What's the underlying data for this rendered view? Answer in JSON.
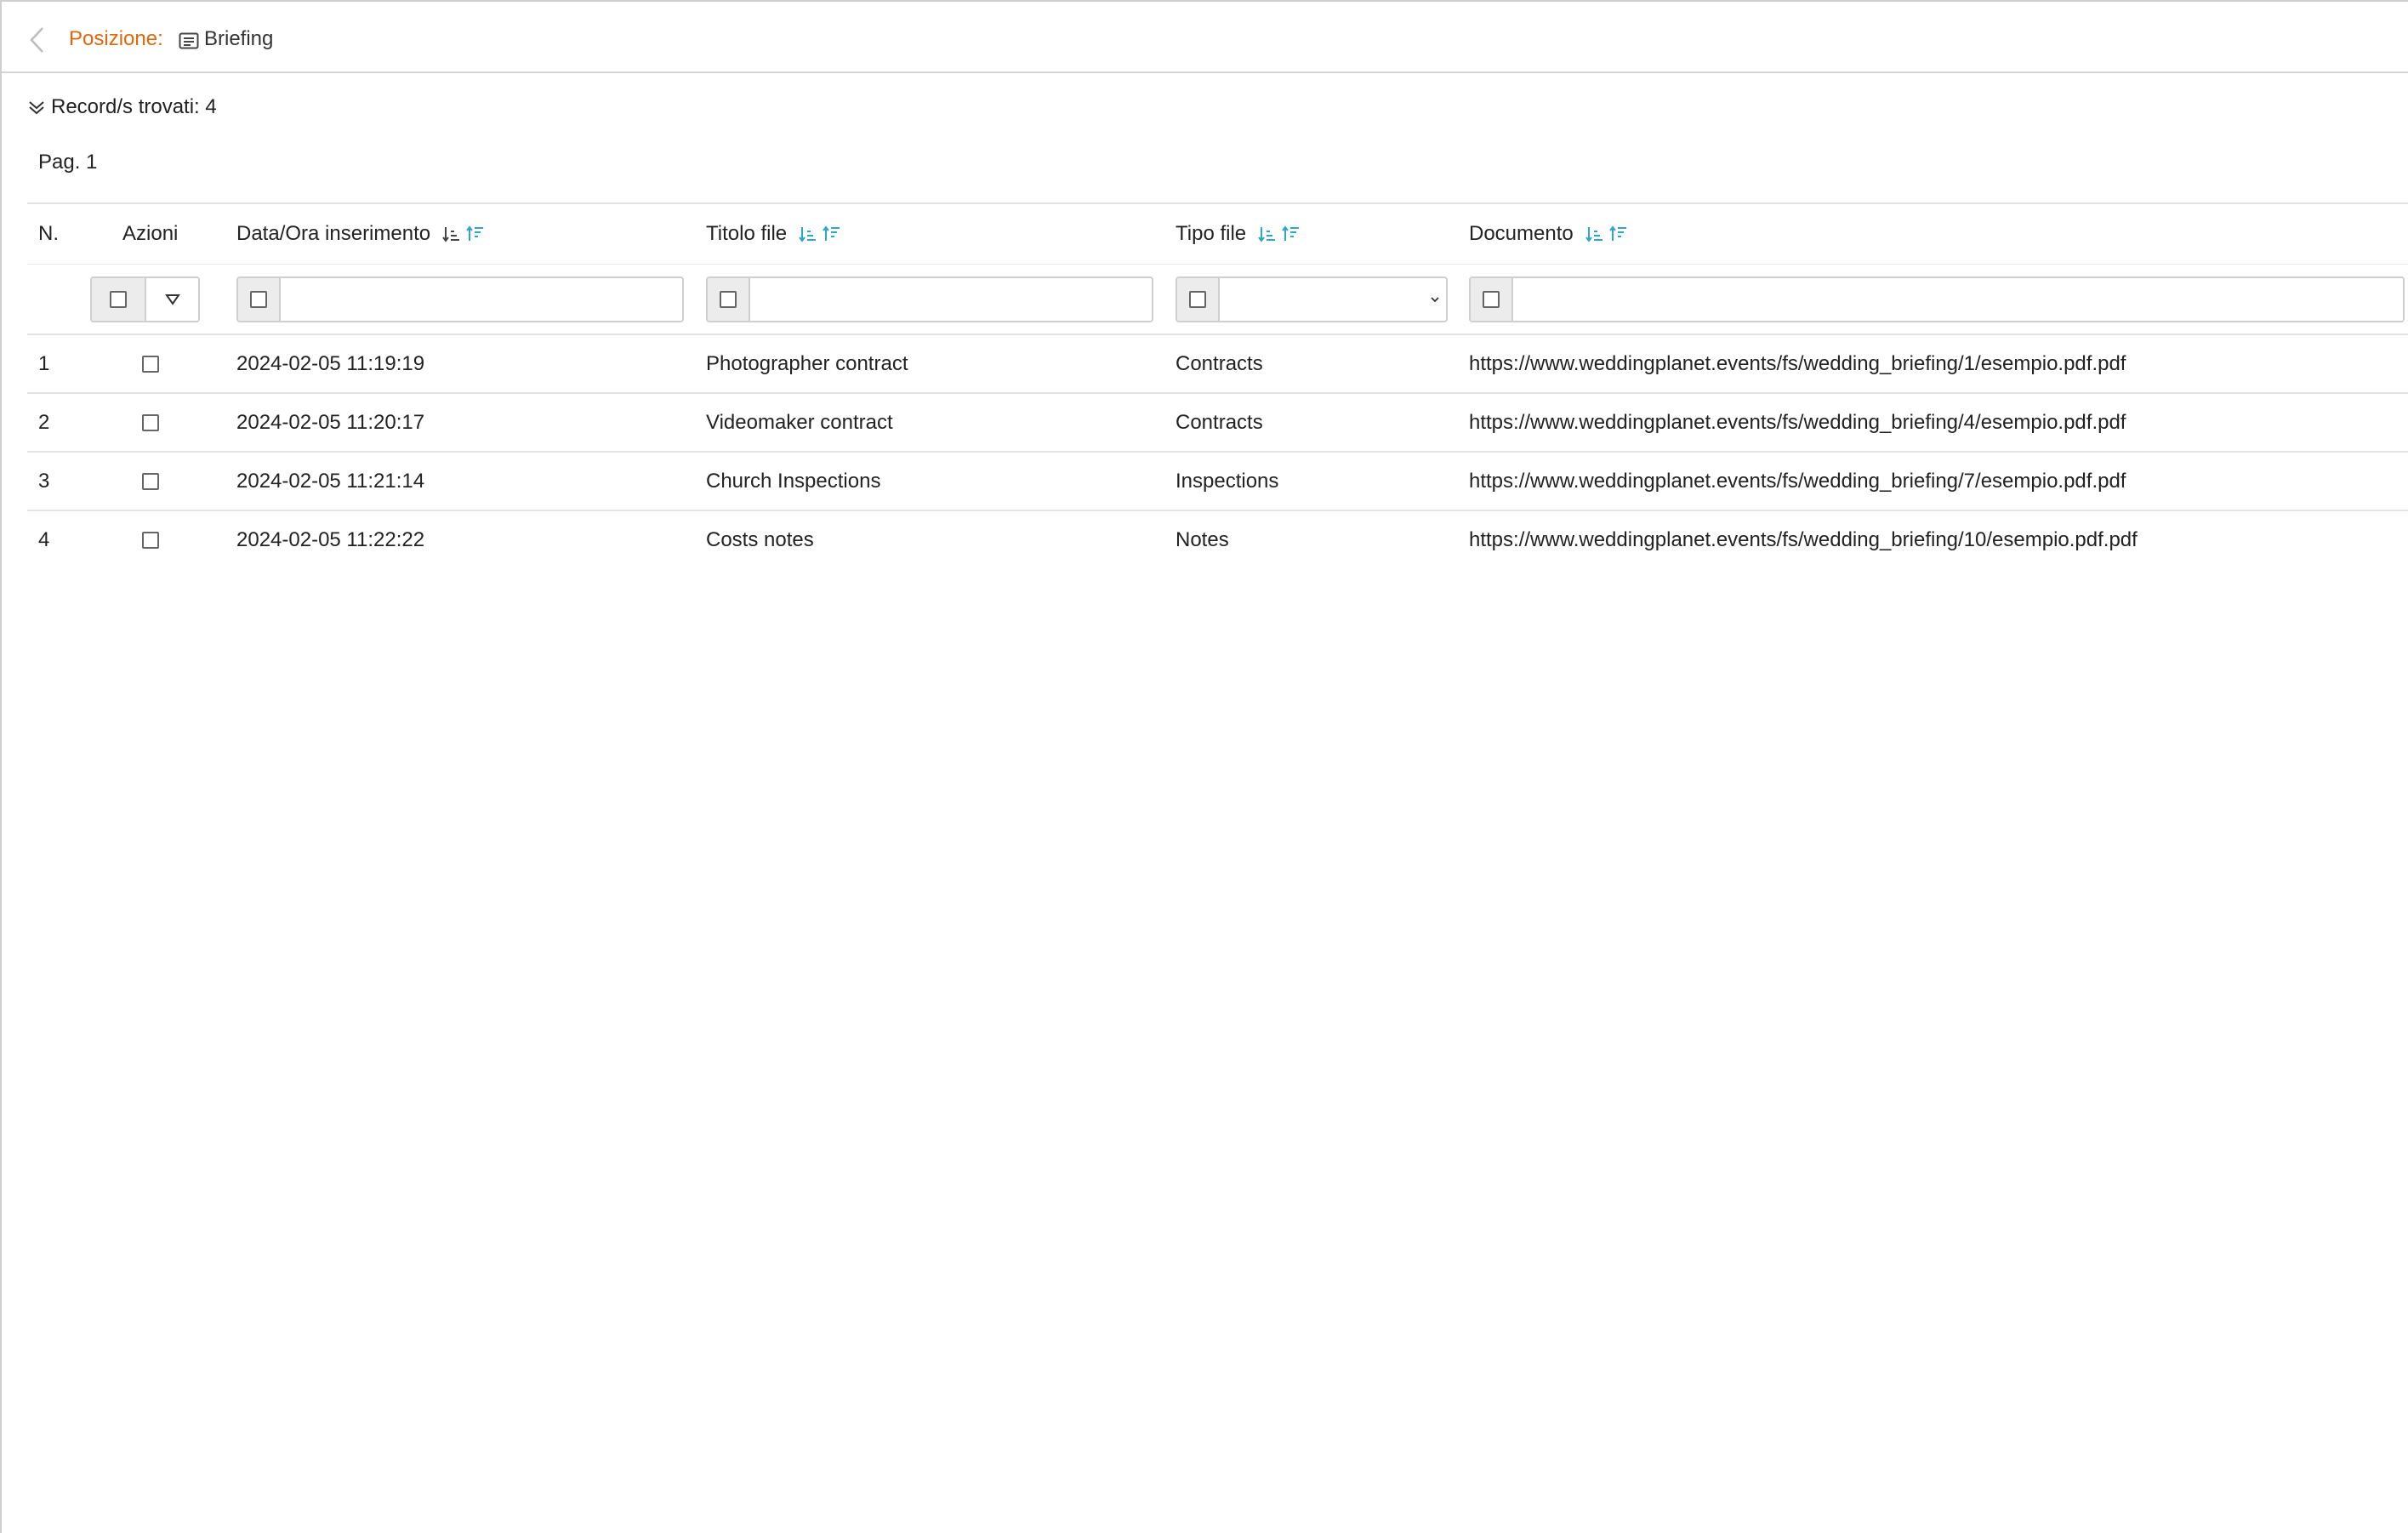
{
  "breadcrumb": {
    "label": "Posizione:",
    "current": "Briefing"
  },
  "records": {
    "label": "Record/s trovati: 4"
  },
  "pagination": {
    "label": "Pag. 1"
  },
  "table": {
    "headers": {
      "n": "N.",
      "actions": "Azioni",
      "date": "Data/Ora inserimento",
      "title": "Titolo file",
      "type": "Tipo file",
      "document": "Documento"
    },
    "rows": [
      {
        "n": "1",
        "date": "2024-02-05 11:19:19",
        "title": "Photographer contract",
        "type": "Contracts",
        "document": "https://www.weddingplanet.events/fs/wedding_briefing/1/esempio.pdf.pdf"
      },
      {
        "n": "2",
        "date": "2024-02-05 11:20:17",
        "title": "Videomaker contract",
        "type": "Contracts",
        "document": "https://www.weddingplanet.events/fs/wedding_briefing/4/esempio.pdf.pdf"
      },
      {
        "n": "3",
        "date": "2024-02-05 11:21:14",
        "title": "Church Inspections",
        "type": "Inspections",
        "document": "https://www.weddingplanet.events/fs/wedding_briefing/7/esempio.pdf.pdf"
      },
      {
        "n": "4",
        "date": "2024-02-05 11:22:22",
        "title": "Costs notes",
        "type": "Notes",
        "document": "https://www.weddingplanet.events/fs/wedding_briefing/10/esempio.pdf.pdf"
      }
    ]
  },
  "colors": {
    "accent": "#e0680c",
    "sort_icon": "#2aa7c9"
  },
  "icons": {
    "back": "chevron-left-icon",
    "page": "document-icon",
    "records": "double-chevron-down-icon",
    "sort_asc": "sort-ascending-icon",
    "sort_desc": "sort-descending-icon",
    "select": "chevron-down-icon",
    "actions": "triangle-down-icon"
  }
}
